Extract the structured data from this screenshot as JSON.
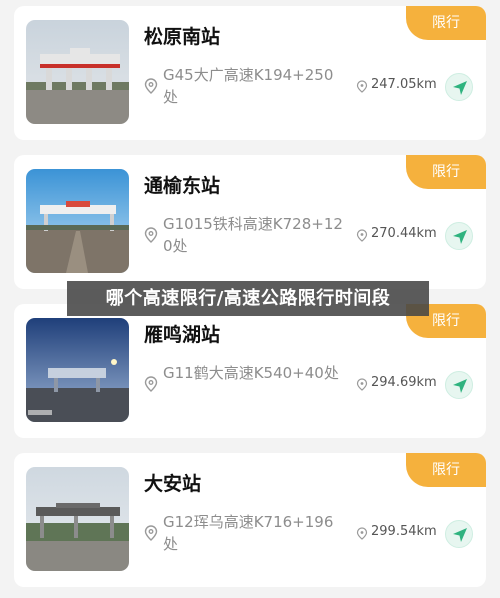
{
  "stations": [
    {
      "name": "松原南站",
      "badge": "限行",
      "address": "G45大广高速K194+250处",
      "distance": "247.05km",
      "nav_icon": "navigate-arrow-icon"
    },
    {
      "name": "通榆东站",
      "badge": "限行",
      "address": "G1015铁科高速K728+120处",
      "distance": "270.44km",
      "nav_icon": "navigate-arrow-icon"
    },
    {
      "name": "雁鸣湖站",
      "badge": "限行",
      "address": "G11鹤大高速K540+40处",
      "distance": "294.69km",
      "nav_icon": "navigate-arrow-icon"
    },
    {
      "name": "大安站",
      "badge": "限行",
      "address": "G12珲乌高速K716+196处",
      "distance": "299.54km",
      "nav_icon": "navigate-arrow-icon"
    }
  ],
  "overlay_banner": "哪个高速限行/高速公路限行时间段",
  "colors": {
    "badge": "#f5b13d",
    "nav_accent": "#2fb37f",
    "address": "#8d8d8d"
  }
}
